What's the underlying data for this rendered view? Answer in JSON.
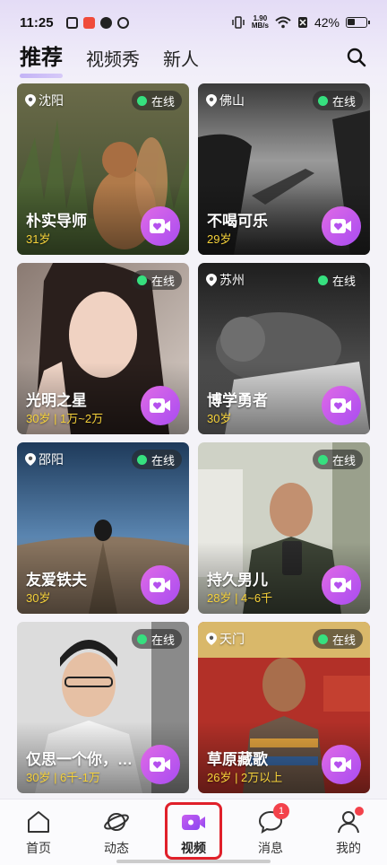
{
  "status_bar": {
    "time": "11:25",
    "net_speed_value": "1.90",
    "net_speed_unit": "MB/s",
    "battery": "42%"
  },
  "tabs": [
    {
      "label": "推荐",
      "active": true
    },
    {
      "label": "视频秀",
      "active": false
    },
    {
      "label": "新人",
      "active": false
    }
  ],
  "header": {
    "search_icon": "search-icon"
  },
  "cards": [
    {
      "location": "沈阳",
      "status": "在线",
      "name": "朴实导师",
      "meta": "31岁"
    },
    {
      "location": "佛山",
      "status": "在线",
      "name": "不喝可乐",
      "meta": "29岁"
    },
    {
      "location": "",
      "status": "在线",
      "name": "光明之星",
      "meta": "30岁 | 1万~2万"
    },
    {
      "location": "苏州",
      "status": "在线",
      "name": "博学勇者",
      "meta": "30岁"
    },
    {
      "location": "邵阳",
      "status": "在线",
      "name": "友爱铁夫",
      "meta": "30岁"
    },
    {
      "location": "",
      "status": "在线",
      "name": "持久男儿",
      "meta": "28岁 | 4~6千"
    },
    {
      "location": "",
      "status": "在线",
      "name": "仅思一个你，…",
      "meta": "30岁 | 6千-1万"
    },
    {
      "location": "天门",
      "status": "在线",
      "name": "草原藏歌",
      "meta": "26岁 | 2万以上"
    }
  ],
  "bottom_nav": [
    {
      "label": "首页",
      "icon": "home-icon"
    },
    {
      "label": "动态",
      "icon": "planet-icon"
    },
    {
      "label": "视频",
      "icon": "video-icon",
      "active": true
    },
    {
      "label": "消息",
      "icon": "message-icon",
      "badge": "1"
    },
    {
      "label": "我的",
      "icon": "user-icon"
    }
  ],
  "colors": {
    "accent": "#a84cf1",
    "online": "#36e07f",
    "meta_text": "#f6d23a",
    "badge": "#f3424b"
  }
}
